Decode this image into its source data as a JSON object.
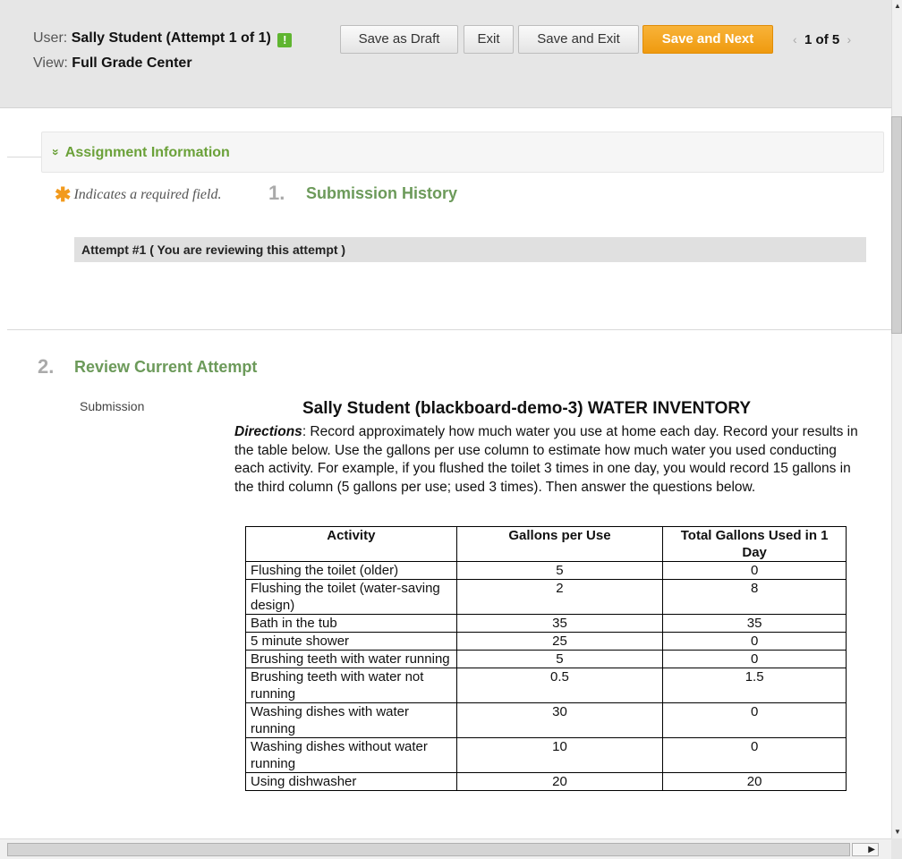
{
  "toolbar": {
    "user_label": "User:",
    "user_name": "Sally Student (Attempt 1 of 1)",
    "flag_glyph": "!",
    "view_label": "View:",
    "view_name": "Full Grade Center",
    "save_draft": "Save as Draft",
    "exit": "Exit",
    "save_exit": "Save and Exit",
    "save_next": "Save and Next",
    "pager_prev": "‹",
    "pager_text": "1 of 5",
    "pager_next": "›",
    "accent_color": "#f0a01e"
  },
  "assignment": {
    "toggle_glyph": "»",
    "heading": "Assignment Information"
  },
  "required": {
    "star": "✱",
    "text": "Indicates a required field."
  },
  "sections": [
    {
      "number": "1.",
      "title": "Submission History"
    },
    {
      "number": "2.",
      "title": "Review Current Attempt"
    }
  ],
  "attempt_bar": "Attempt #1 ( You are reviewing this attempt )",
  "submission": {
    "label": "Submission",
    "doc_title": "Sally Student (blackboard-demo-3) WATER INVENTORY",
    "directions_label": "Directions",
    "directions_text": ": Record approximately how much water you use at home each day. Record your results in the table below. Use the gallons per use column to estimate how much water you used conducting each activity. For example, if you flushed the toilet 3 times in one day, you would record 15 gallons in the third column (5 gallons per use; used 3 times). Then answer the questions below."
  },
  "table": {
    "headers": [
      "Activity",
      "Gallons per Use",
      "Total Gallons Used in 1 Day"
    ],
    "rows": [
      [
        "Flushing the toilet (older)",
        "5",
        "0"
      ],
      [
        "Flushing the toilet (water-saving design)",
        "2",
        "8"
      ],
      [
        "Bath in the tub",
        "35",
        "35"
      ],
      [
        "5 minute shower",
        "25",
        "0"
      ],
      [
        "Brushing teeth with water running",
        "5",
        "0"
      ],
      [
        "Brushing teeth with water not running",
        "0.5",
        "1.5"
      ],
      [
        "Washing dishes with water running",
        "30",
        "0"
      ],
      [
        "Washing dishes without water running",
        "10",
        "0"
      ],
      [
        "Using dishwasher",
        "20",
        "20"
      ]
    ]
  }
}
